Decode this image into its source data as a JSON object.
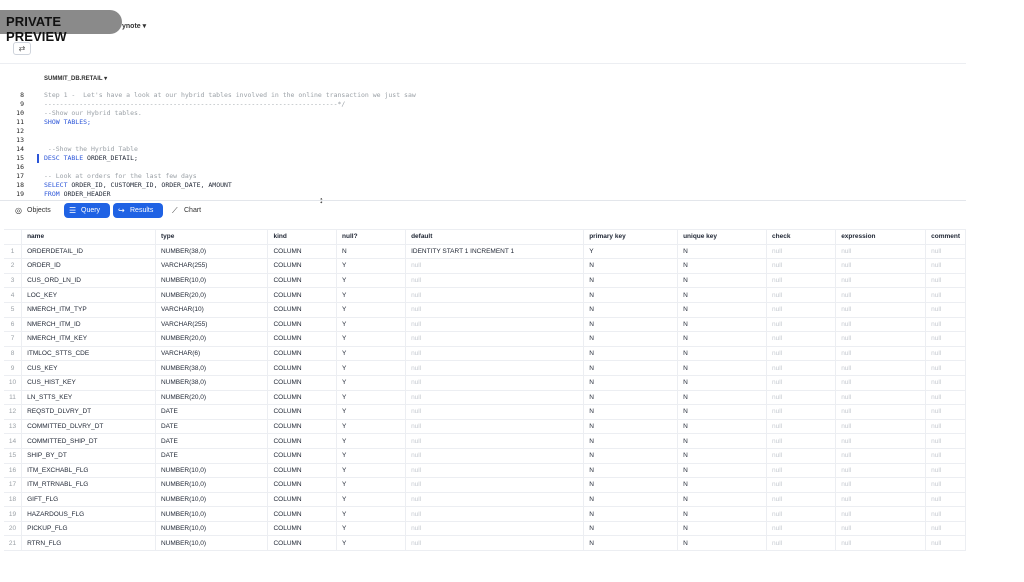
{
  "banner": "PRIVATE PREVIEW",
  "worksheet_name": "ynote ▾",
  "toolbar": {
    "filter_icon": "⇄"
  },
  "context": {
    "database": "SUMMIT_DB.RETAIL ▾"
  },
  "editor": {
    "lines": [
      {
        "num": "8",
        "segments": [
          {
            "t": "Step 1 -  Let's have a look at our hybrid tables involved in the online transaction we just saw",
            "c": "cm"
          }
        ]
      },
      {
        "num": "9",
        "segments": [
          {
            "t": "---------------------------------------------------------------------------*/",
            "c": "cm"
          }
        ]
      },
      {
        "num": "10",
        "segments": [
          {
            "t": "--Show our Hybrid tables.",
            "c": "cm"
          }
        ]
      },
      {
        "num": "11",
        "segments": [
          {
            "t": "SHOW TABLES;",
            "c": "kw"
          }
        ]
      },
      {
        "num": "12",
        "segments": []
      },
      {
        "num": "13",
        "segments": []
      },
      {
        "num": "14",
        "segments": [
          {
            "t": " --Show the Hyrbid Table",
            "c": "cm"
          }
        ]
      },
      {
        "num": "15",
        "segments": [
          {
            "t": "DESC TABLE",
            "c": "kw"
          },
          {
            "t": " ORDER_DETAIL;",
            "c": ""
          }
        ]
      },
      {
        "num": "16",
        "segments": []
      },
      {
        "num": "17",
        "segments": [
          {
            "t": "-- Look at orders for the last few days",
            "c": "cm"
          }
        ]
      },
      {
        "num": "18",
        "segments": [
          {
            "t": "SELECT",
            "c": "kw"
          },
          {
            "t": " ORDER_ID, CUSTOMER_ID, ORDER_DATE, AMOUNT",
            "c": ""
          }
        ]
      },
      {
        "num": "19",
        "segments": [
          {
            "t": "FROM",
            "c": "kw"
          },
          {
            "t": " ORDER_HEADER",
            "c": ""
          }
        ]
      }
    ]
  },
  "resize_icon": "↕",
  "tabs": {
    "objects": {
      "icon": "◎",
      "label": "Objects"
    },
    "query": {
      "icon": "☰",
      "label": "Query"
    },
    "results": {
      "icon": "↪",
      "label": "Results"
    },
    "chart": {
      "icon": "⟋",
      "label": "Chart"
    }
  },
  "grid": {
    "columns": [
      "name",
      "type",
      "kind",
      "null?",
      "default",
      "primary key",
      "unique key",
      "check",
      "expression",
      "comment"
    ],
    "rows": [
      [
        "1",
        "ORDERDETAIL_ID",
        "NUMBER(38,0)",
        "COLUMN",
        "N",
        "IDENTITY START 1 INCREMENT 1",
        "Y",
        "N",
        "null",
        "null",
        "null"
      ],
      [
        "2",
        "ORDER_ID",
        "VARCHAR(255)",
        "COLUMN",
        "Y",
        "null",
        "N",
        "N",
        "null",
        "null",
        "null"
      ],
      [
        "3",
        "CUS_ORD_LN_ID",
        "NUMBER(10,0)",
        "COLUMN",
        "Y",
        "null",
        "N",
        "N",
        "null",
        "null",
        "null"
      ],
      [
        "4",
        "LOC_KEY",
        "NUMBER(20,0)",
        "COLUMN",
        "Y",
        "null",
        "N",
        "N",
        "null",
        "null",
        "null"
      ],
      [
        "5",
        "NMERCH_ITM_TYP",
        "VARCHAR(10)",
        "COLUMN",
        "Y",
        "null",
        "N",
        "N",
        "null",
        "null",
        "null"
      ],
      [
        "6",
        "NMERCH_ITM_ID",
        "VARCHAR(255)",
        "COLUMN",
        "Y",
        "null",
        "N",
        "N",
        "null",
        "null",
        "null"
      ],
      [
        "7",
        "NMERCH_ITM_KEY",
        "NUMBER(20,0)",
        "COLUMN",
        "Y",
        "null",
        "N",
        "N",
        "null",
        "null",
        "null"
      ],
      [
        "8",
        "ITMLOC_STTS_CDE",
        "VARCHAR(6)",
        "COLUMN",
        "Y",
        "null",
        "N",
        "N",
        "null",
        "null",
        "null"
      ],
      [
        "9",
        "CUS_KEY",
        "NUMBER(38,0)",
        "COLUMN",
        "Y",
        "null",
        "N",
        "N",
        "null",
        "null",
        "null"
      ],
      [
        "10",
        "CUS_HIST_KEY",
        "NUMBER(38,0)",
        "COLUMN",
        "Y",
        "null",
        "N",
        "N",
        "null",
        "null",
        "null"
      ],
      [
        "11",
        "LN_STTS_KEY",
        "NUMBER(20,0)",
        "COLUMN",
        "Y",
        "null",
        "N",
        "N",
        "null",
        "null",
        "null"
      ],
      [
        "12",
        "REQSTD_DLVRY_DT",
        "DATE",
        "COLUMN",
        "Y",
        "null",
        "N",
        "N",
        "null",
        "null",
        "null"
      ],
      [
        "13",
        "COMMITTED_DLVRY_DT",
        "DATE",
        "COLUMN",
        "Y",
        "null",
        "N",
        "N",
        "null",
        "null",
        "null"
      ],
      [
        "14",
        "COMMITTED_SHIP_DT",
        "DATE",
        "COLUMN",
        "Y",
        "null",
        "N",
        "N",
        "null",
        "null",
        "null"
      ],
      [
        "15",
        "SHIP_BY_DT",
        "DATE",
        "COLUMN",
        "Y",
        "null",
        "N",
        "N",
        "null",
        "null",
        "null"
      ],
      [
        "16",
        "ITM_EXCHABL_FLG",
        "NUMBER(10,0)",
        "COLUMN",
        "Y",
        "null",
        "N",
        "N",
        "null",
        "null",
        "null"
      ],
      [
        "17",
        "ITM_RTRNABL_FLG",
        "NUMBER(10,0)",
        "COLUMN",
        "Y",
        "null",
        "N",
        "N",
        "null",
        "null",
        "null"
      ],
      [
        "18",
        "GIFT_FLG",
        "NUMBER(10,0)",
        "COLUMN",
        "Y",
        "null",
        "N",
        "N",
        "null",
        "null",
        "null"
      ],
      [
        "19",
        "HAZARDOUS_FLG",
        "NUMBER(10,0)",
        "COLUMN",
        "Y",
        "null",
        "N",
        "N",
        "null",
        "null",
        "null"
      ],
      [
        "20",
        "PICKUP_FLG",
        "NUMBER(10,0)",
        "COLUMN",
        "Y",
        "null",
        "N",
        "N",
        "null",
        "null",
        "null"
      ],
      [
        "21",
        "RTRN_FLG",
        "NUMBER(10,0)",
        "COLUMN",
        "Y",
        "null",
        "N",
        "N",
        "null",
        "null",
        "null"
      ]
    ]
  },
  "colors": {
    "accent": "#1f62e4",
    "keyword": "#2b55d8",
    "comment": "#9aa0a6",
    "null_text": "#c6cad1"
  }
}
